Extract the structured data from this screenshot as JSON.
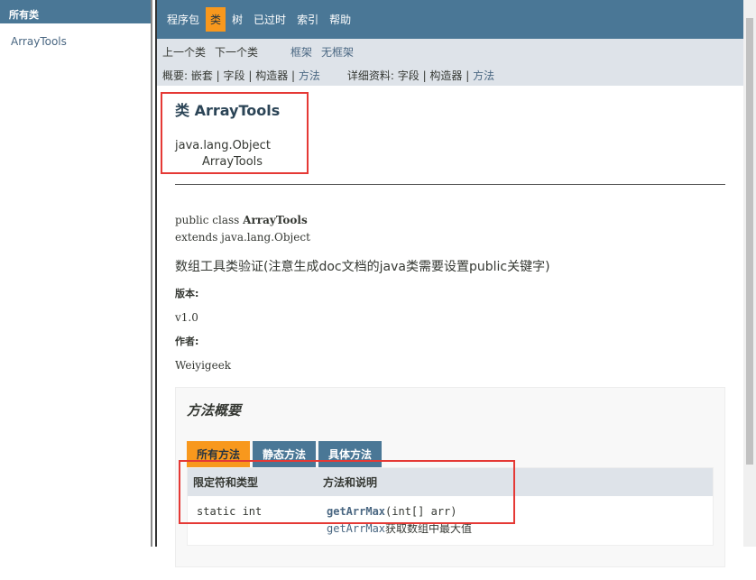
{
  "left": {
    "header": "所有类",
    "items": [
      "ArrayTools"
    ]
  },
  "topnav": [
    "程序包",
    "类",
    "树",
    "已过时",
    "索引",
    "帮助"
  ],
  "subnav": {
    "prev": "上一个类",
    "next": "下一个类",
    "frames": "框架",
    "noframes": "无框架",
    "summary": "概要: 嵌套 | 字段 | 构造器 |",
    "summary_method": "方法",
    "detail": "详细资料: 字段 | 构造器 |",
    "detail_method": "方法"
  },
  "title": "类 ArrayTools",
  "inherit": [
    "java.lang.Object",
    "ArrayTools"
  ],
  "decl": {
    "l1a": "public class ",
    "l1b": "ArrayTools",
    "l2": "extends java.lang.Object"
  },
  "desc": "数组工具类验证(注意生成doc文档的java类需要设置public关键字)",
  "version_label": "版本:",
  "version": "v1.0",
  "author_label": "作者:",
  "author": "Weiyigeek",
  "summary": {
    "title": "方法概要",
    "tabs": [
      "所有方法",
      "静态方法",
      "具体方法"
    ],
    "col1": "限定符和类型",
    "col2": "方法和说明",
    "rows": [
      {
        "type": "static int",
        "method": "getArrMax",
        "params": "(int[]  arr)",
        "desc_method": "getArrMax",
        "desc": "获取数组中最大值"
      }
    ]
  }
}
